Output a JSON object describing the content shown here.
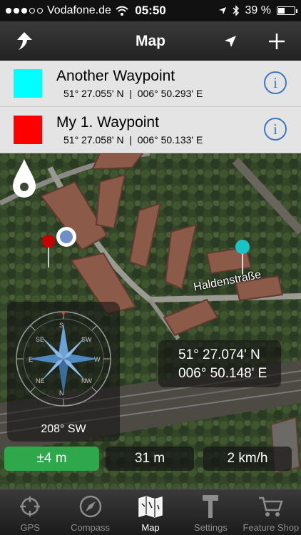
{
  "status_bar": {
    "carrier": "Vodafone.de",
    "time": "05:50",
    "battery_text": "39 %",
    "battery_level": 0.39
  },
  "nav": {
    "title": "Map",
    "icons": [
      "share-arrow-icon",
      "location-arrow-icon",
      "plus-icon"
    ]
  },
  "waypoints": [
    {
      "name": "Another Waypoint",
      "coords": "51° 27.055' N  |  006° 50.293' E",
      "color": "#00ffff"
    },
    {
      "name": "My 1. Waypoint",
      "coords": "51° 27.058' N  |  006° 50.133' E",
      "color": "#ff0000"
    }
  ],
  "map": {
    "street_name": "Haldenstraße",
    "compass_heading": "208° SW",
    "current_lat": "51° 27.074' N",
    "current_lon": "006° 50.148' E",
    "accuracy": "±4 m",
    "altitude": "31 m",
    "speed": "2 km/h",
    "accuracy_color": "#2ea84a"
  },
  "tabs": [
    {
      "label": "GPS",
      "icon": "crosshair-icon",
      "active": false
    },
    {
      "label": "Compass",
      "icon": "compass-icon",
      "active": false
    },
    {
      "label": "Map",
      "icon": "map-icon",
      "active": true
    },
    {
      "label": "Settings",
      "icon": "hammer-icon",
      "active": false
    },
    {
      "label": "Feature Shop",
      "icon": "cart-icon",
      "active": false
    }
  ]
}
